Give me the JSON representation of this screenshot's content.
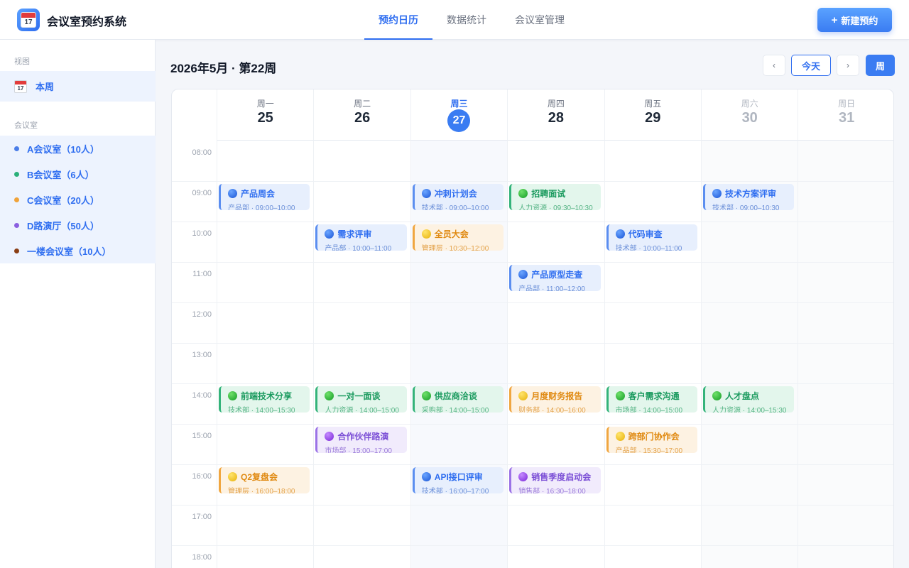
{
  "app": {
    "title": "会议室预约系统",
    "logo_day": "17"
  },
  "nav": {
    "tabs": [
      "预约日历",
      "数据统计",
      "会议室管理"
    ],
    "active": 0
  },
  "header": {
    "new_button": "新建预约",
    "new_icon": "plus-icon"
  },
  "sidebar": {
    "view_section": "视图",
    "view_item": "本周",
    "view_icon_day": "17",
    "rooms_section": "会议室",
    "rooms": [
      {
        "label": "A会议室（10人）",
        "color": "#4a7de8"
      },
      {
        "label": "B会议室（6人）",
        "color": "#2bb07a"
      },
      {
        "label": "C会议室（20人）",
        "color": "#f0a33a"
      },
      {
        "label": "D路演厅（50人）",
        "color": "#8a5fe0"
      },
      {
        "label": "一楼会议室（10人）",
        "color": "#8a3f15"
      }
    ]
  },
  "toolbar": {
    "week_title": "2026年5月 · 第22周",
    "prev": "‹",
    "today": "今天",
    "next": "›",
    "view_mode": "周"
  },
  "calendar": {
    "days": [
      {
        "weekday": "周一",
        "date": "25",
        "state": "normal"
      },
      {
        "weekday": "周二",
        "date": "26",
        "state": "normal"
      },
      {
        "weekday": "周三",
        "date": "27",
        "state": "today"
      },
      {
        "weekday": "周四",
        "date": "28",
        "state": "normal"
      },
      {
        "weekday": "周五",
        "date": "29",
        "state": "normal"
      },
      {
        "weekday": "周六",
        "date": "30",
        "state": "weekend"
      },
      {
        "weekday": "周日",
        "date": "31",
        "state": "weekend"
      }
    ],
    "hours": [
      "08:00",
      "09:00",
      "10:00",
      "11:00",
      "12:00",
      "13:00",
      "14:00",
      "15:00",
      "16:00",
      "17:00",
      "18:00"
    ],
    "events": [
      {
        "day": 0,
        "title": "产品周会",
        "sub": "产品部 · 09:00–10:00",
        "start": 9,
        "color": "blue"
      },
      {
        "day": 0,
        "title": "前端技术分享",
        "sub": "技术部 · 14:00–15:30",
        "start": 14,
        "color": "green"
      },
      {
        "day": 0,
        "title": "Q2复盘会",
        "sub": "管理层 · 16:00–18:00",
        "start": 16,
        "color": "orange"
      },
      {
        "day": 1,
        "title": "需求评审",
        "sub": "产品部 · 10:00–11:00",
        "start": 10,
        "color": "blue"
      },
      {
        "day": 1,
        "title": "一对一面谈",
        "sub": "人力资源 · 14:00–15:00",
        "start": 14,
        "color": "green"
      },
      {
        "day": 1,
        "title": "合作伙伴路演",
        "sub": "市场部 · 15:00–17:00",
        "start": 15,
        "color": "purple"
      },
      {
        "day": 2,
        "title": "冲刺计划会",
        "sub": "技术部 · 09:00–10:00",
        "start": 9,
        "color": "blue"
      },
      {
        "day": 2,
        "title": "全员大会",
        "sub": "管理层 · 10:30–12:00",
        "start": 10,
        "color": "orange"
      },
      {
        "day": 2,
        "title": "供应商洽谈",
        "sub": "采购部 · 14:00–15:00",
        "start": 14,
        "color": "green"
      },
      {
        "day": 2,
        "title": "API接口评审",
        "sub": "技术部 · 16:00–17:00",
        "start": 16,
        "color": "blue"
      },
      {
        "day": 3,
        "title": "招聘面试",
        "sub": "人力资源 · 09:30–10:30",
        "start": 9,
        "color": "green"
      },
      {
        "day": 3,
        "title": "产品原型走查",
        "sub": "产品部 · 11:00–12:00",
        "start": 11,
        "color": "blue"
      },
      {
        "day": 3,
        "title": "月度财务报告",
        "sub": "财务部 · 14:00–16:00",
        "start": 14,
        "color": "orange"
      },
      {
        "day": 3,
        "title": "销售季度启动会",
        "sub": "销售部 · 16:30–18:00",
        "start": 16,
        "color": "purple"
      },
      {
        "day": 4,
        "title": "代码审查",
        "sub": "技术部 · 10:00–11:00",
        "start": 10,
        "color": "blue"
      },
      {
        "day": 4,
        "title": "客户需求沟通",
        "sub": "市场部 · 14:00–15:00",
        "start": 14,
        "color": "green"
      },
      {
        "day": 4,
        "title": "跨部门协作会",
        "sub": "产品部 · 15:30–17:00",
        "start": 15,
        "color": "orange"
      },
      {
        "day": 5,
        "title": "技术方案评审",
        "sub": "技术部 · 09:00–10:30",
        "start": 9,
        "color": "blue"
      },
      {
        "day": 5,
        "title": "人才盘点",
        "sub": "人力资源 · 14:00–15:30",
        "start": 14,
        "color": "green"
      }
    ]
  }
}
